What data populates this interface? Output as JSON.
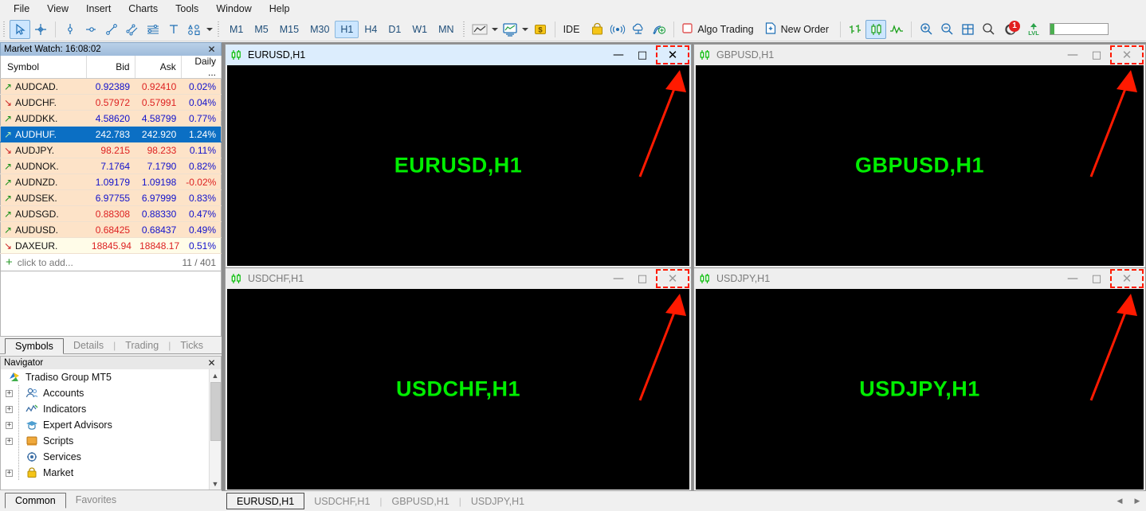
{
  "menu": {
    "items": [
      "File",
      "View",
      "Insert",
      "Charts",
      "Tools",
      "Window",
      "Help"
    ]
  },
  "toolbar": {
    "timeframes": [
      {
        "label": "M1",
        "active": false
      },
      {
        "label": "M5",
        "active": false
      },
      {
        "label": "M15",
        "active": false
      },
      {
        "label": "M30",
        "active": false
      },
      {
        "label": "H1",
        "active": true
      },
      {
        "label": "H4",
        "active": false
      },
      {
        "label": "D1",
        "active": false
      },
      {
        "label": "W1",
        "active": false
      },
      {
        "label": "MN",
        "active": false
      }
    ],
    "ide_label": "IDE",
    "algo_trading_label": "Algo Trading",
    "new_order_label": "New Order",
    "lvl_label": "LVL",
    "notification_count": "1",
    "icons": [
      "cursor-icon",
      "crosshair-icon",
      "vertical-line-icon",
      "horizontal-line-icon",
      "trend-line-icon",
      "equidistant-channel-icon",
      "fibonacci-icon",
      "text-label-icon",
      "shapes-icon",
      "line-chart-icon",
      "indicators-icon",
      "dollar-icon",
      "ide-icon",
      "market-icon",
      "signals-icon",
      "cloud-icon",
      "vps-icon",
      "bar-chart-icon",
      "candlestick-icon",
      "line-mode-icon",
      "zoom-in-icon",
      "zoom-out-icon",
      "tile-windows-icon",
      "search-icon",
      "notifications-icon",
      "lvl-icon"
    ]
  },
  "market_watch": {
    "title": "Market Watch: 16:08:02",
    "columns": [
      "Symbol",
      "Bid",
      "Ask",
      "Daily ..."
    ],
    "rows": [
      {
        "dir": "up",
        "symbol": "AUDCAD.",
        "bid": "0.92389",
        "bid_color": "blue",
        "ask": "0.92410",
        "ask_color": "red",
        "daily": "0.02%",
        "daily_color": "blue",
        "selected": false,
        "alt": false
      },
      {
        "dir": "down",
        "symbol": "AUDCHF.",
        "bid": "0.57972",
        "bid_color": "red",
        "ask": "0.57991",
        "ask_color": "red",
        "daily": "0.04%",
        "daily_color": "blue",
        "selected": false,
        "alt": false
      },
      {
        "dir": "up",
        "symbol": "AUDDKK.",
        "bid": "4.58620",
        "bid_color": "blue",
        "ask": "4.58799",
        "ask_color": "blue",
        "daily": "0.77%",
        "daily_color": "blue",
        "selected": false,
        "alt": false
      },
      {
        "dir": "up",
        "symbol": "AUDHUF.",
        "bid": "242.783",
        "bid_color": "blue",
        "ask": "242.920",
        "ask_color": "blue",
        "daily": "1.24%",
        "daily_color": "blue",
        "selected": true,
        "alt": false
      },
      {
        "dir": "down",
        "symbol": "AUDJPY.",
        "bid": "98.215",
        "bid_color": "red",
        "ask": "98.233",
        "ask_color": "red",
        "daily": "0.11%",
        "daily_color": "blue",
        "selected": false,
        "alt": false
      },
      {
        "dir": "up",
        "symbol": "AUDNOK.",
        "bid": "7.1764",
        "bid_color": "blue",
        "ask": "7.1790",
        "ask_color": "blue",
        "daily": "0.82%",
        "daily_color": "blue",
        "selected": false,
        "alt": false
      },
      {
        "dir": "up",
        "symbol": "AUDNZD.",
        "bid": "1.09179",
        "bid_color": "blue",
        "ask": "1.09198",
        "ask_color": "blue",
        "daily": "-0.02%",
        "daily_color": "red",
        "selected": false,
        "alt": false
      },
      {
        "dir": "up",
        "symbol": "AUDSEK.",
        "bid": "6.97755",
        "bid_color": "blue",
        "ask": "6.97999",
        "ask_color": "blue",
        "daily": "0.83%",
        "daily_color": "blue",
        "selected": false,
        "alt": false
      },
      {
        "dir": "up",
        "symbol": "AUDSGD.",
        "bid": "0.88308",
        "bid_color": "red",
        "ask": "0.88330",
        "ask_color": "blue",
        "daily": "0.47%",
        "daily_color": "blue",
        "selected": false,
        "alt": false
      },
      {
        "dir": "up",
        "symbol": "AUDUSD.",
        "bid": "0.68425",
        "bid_color": "red",
        "ask": "0.68437",
        "ask_color": "blue",
        "daily": "0.49%",
        "daily_color": "blue",
        "selected": false,
        "alt": false
      },
      {
        "dir": "down",
        "symbol": "DAXEUR.",
        "bid": "18845.94",
        "bid_color": "red",
        "ask": "18848.17",
        "ask_color": "red",
        "daily": "0.51%",
        "daily_color": "blue",
        "selected": false,
        "alt": true
      }
    ],
    "add_label": "click to add...",
    "count": "11 / 401",
    "tabs": [
      {
        "label": "Symbols",
        "active": true
      },
      {
        "label": "Details",
        "active": false
      },
      {
        "label": "Trading",
        "active": false
      },
      {
        "label": "Ticks",
        "active": false
      }
    ]
  },
  "navigator": {
    "title": "Navigator",
    "root": "Tradiso Group MT5",
    "items": [
      {
        "label": "Accounts",
        "icon": "accounts-icon",
        "expandable": true
      },
      {
        "label": "Indicators",
        "icon": "indicators-icon",
        "expandable": true
      },
      {
        "label": "Expert Advisors",
        "icon": "expert-advisors-icon",
        "expandable": true
      },
      {
        "label": "Scripts",
        "icon": "scripts-icon",
        "expandable": true
      },
      {
        "label": "Services",
        "icon": "services-icon",
        "expandable": false
      },
      {
        "label": "Market",
        "icon": "market-icon",
        "expandable": true
      }
    ],
    "tabs": [
      {
        "label": "Common",
        "active": true
      },
      {
        "label": "Favorites",
        "active": false
      }
    ]
  },
  "charts": [
    {
      "title": "EURUSD,H1",
      "watermark": "EURUSD,H1",
      "active": true,
      "name": "eurusd"
    },
    {
      "title": "GBPUSD,H1",
      "watermark": "GBPUSD,H1",
      "active": false,
      "name": "gbpusd"
    },
    {
      "title": "USDCHF,H1",
      "watermark": "USDCHF,H1",
      "active": false,
      "name": "usdchf"
    },
    {
      "title": "USDJPY,H1",
      "watermark": "USDJPY,H1",
      "active": false,
      "name": "usdjpy"
    }
  ],
  "chart_tabs": [
    {
      "label": "EURUSD,H1",
      "active": true
    },
    {
      "label": "USDCHF,H1",
      "active": false
    },
    {
      "label": "GBPUSD,H1",
      "active": false
    },
    {
      "label": "USDJPY,H1",
      "active": false
    }
  ],
  "window_buttons": {
    "minimize": "—",
    "maximize": "□",
    "close": "✕"
  },
  "colors": {
    "accent": "#0b6fc4",
    "watermark_green": "#00ee00",
    "annotation_red": "#ff1a00",
    "quote_blue": "#1111cc",
    "quote_red": "#dd2222",
    "row_bg": "#fde3c8"
  }
}
